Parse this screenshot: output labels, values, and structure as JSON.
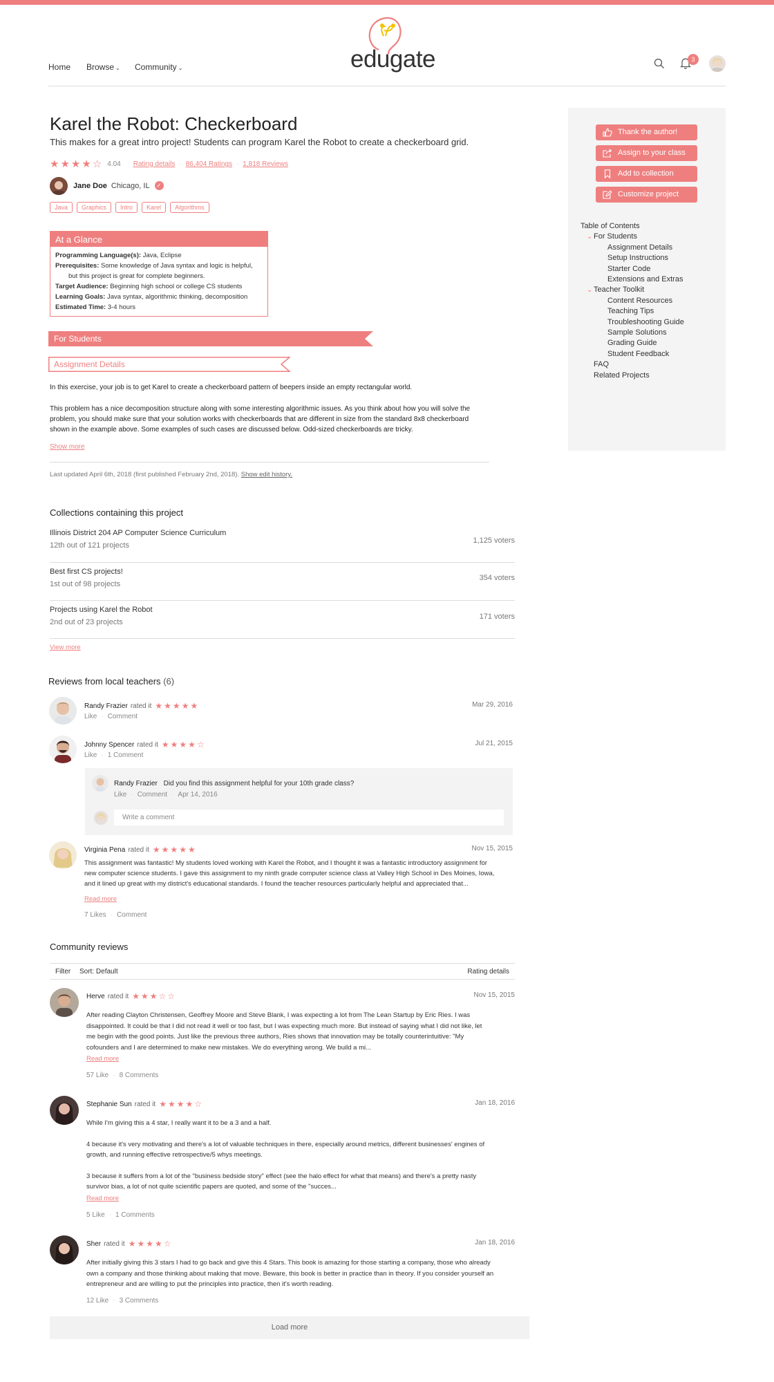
{
  "header": {
    "nav": [
      {
        "label": "Home",
        "dropdown": false
      },
      {
        "label": "Browse",
        "dropdown": true
      },
      {
        "label": "Community",
        "dropdown": true
      }
    ],
    "logo_text": "edugate",
    "notifications_count": "3",
    "accent_color": "#ef7f7f"
  },
  "project": {
    "title": "Karel the Robot: Checkerboard",
    "subtitle": "This makes for a great intro project! Students can program Karel the Robot to create a checkerboard grid.",
    "rating_value": "4.04",
    "rating_stars": 4,
    "rating_details_link": "Rating details",
    "ratings_link": "86,404 Ratings",
    "reviews_link": "1,818 Reviews",
    "author_name": "Jane Doe",
    "author_location": "Chicago, IL",
    "tags": [
      "Java",
      "Graphics",
      "Intro",
      "Karel",
      "Algorithms"
    ]
  },
  "glance": {
    "heading": "At a Glance",
    "items": [
      {
        "label": "Programming Language(s):",
        "value": "Java, Eclipse"
      },
      {
        "label": "Prerequisites:",
        "value": "Some knowledge of Java syntax and logic is helpful,",
        "value2": "but this project is great for complete beginners."
      },
      {
        "label": "Target Audience:",
        "value": "Beginning high school or college CS students"
      },
      {
        "label": "Learning Goals:",
        "value": "Java syntax, algorithmic thinking, decomposition"
      },
      {
        "label": "Estimated Time:",
        "value": "3-4 hours"
      }
    ]
  },
  "content": {
    "section_ribbon": "For Students",
    "subsection_ribbon": "Assignment Details",
    "paragraph1": "In this exercise, your job is to get Karel to create a checkerboard pattern of beepers inside an empty rectangular world.",
    "paragraph2_lines": [
      "This problem has a nice decomposition structure along with some interesting algorithmic issues. As you think about how you will solve the",
      "problem, you should make sure that your solution works with checkerboards that are different in size from the standard 8x8 checkerboard",
      "shown in the example above. Some examples of such cases are discussed below. Odd-sized checkerboards are tricky."
    ],
    "show_more": "Show more",
    "last_updated": "Last updated April 6th, 2018 (first published February 2nd, 2018).",
    "edit_history_link": "Show edit history."
  },
  "collections": {
    "title": "Collections containing this project",
    "items": [
      {
        "name": "Illinois District 204 AP Computer Science Curriculum",
        "rank": "12th out of 121 projects",
        "voters": "1,125 voters"
      },
      {
        "name": "Best first CS projects!",
        "rank": "1st out of 98 projects",
        "voters": "354 voters"
      },
      {
        "name": "Projects using Karel the Robot",
        "rank": "2nd out of 23 projects",
        "voters": "171 voters"
      }
    ],
    "view_more": "View more"
  },
  "local_reviews": {
    "title": "Reviews from local teachers",
    "count": "(6)",
    "rated_it": "rated it",
    "items": [
      {
        "name": "Randy Frazier",
        "stars": 5,
        "date": "Mar 29, 2016",
        "like": "Like",
        "comment": "Comment"
      },
      {
        "name": "Johnny Spencer",
        "stars": 4,
        "date": "Jul 21, 2015",
        "like": "Like",
        "comment": "1 Comment"
      },
      {
        "name": "Virginia Pena",
        "stars": 5,
        "date": "Nov 15, 2015",
        "text_lines": [
          "This assignment was fantastic! My students loved working with Karel the Robot, and I thought it was a fantastic introductory assignment for",
          "new computer science students. I gave this assignment to my ninth grade computer science class at Valley High School in Des Moines, Iowa,",
          "and it lined up great with my district's educational standards. I found the teacher resources particularly helpful and appreciated that..."
        ],
        "read_more": "Read more",
        "like": "7 Likes",
        "comment": "Comment"
      }
    ],
    "reply": {
      "name": "Randy Frazier",
      "text": "Did you find this assignment helpful for your 10th grade class?",
      "like": "Like",
      "comment": "Comment",
      "date": "Apr 14, 2016",
      "input_placeholder": "Write a comment"
    }
  },
  "community": {
    "title": "Community reviews",
    "filter": "Filter",
    "sort_label": "Sort:",
    "sort_value": "Default",
    "rating_details": "Rating details",
    "rated_it": "rated it",
    "items": [
      {
        "name": "Herve",
        "stars": 3,
        "date": "Nov 15, 2015",
        "paragraphs": [
          [
            "After reading Clayton Christensen, Geoffrey Moore and Steve Blank, I was expecting a lot from The Lean Startup by Eric Ries. I was",
            "disappointed. It could be that I did not read it well or too fast, but I was expecting much more. But instead of saying what I did not like, let",
            "me begin with the good points. Just like the previous three authors, Ries shows that innovation may be totally counterintuitive: \"My",
            "cofounders and I are determined to make new mistakes. We do everything wrong. We build a mi..."
          ]
        ],
        "read_more": "Read more",
        "like": "57 Like",
        "comment": "8 Comments"
      },
      {
        "name": "Stephanie Sun",
        "stars": 4,
        "date": "Jan 18, 2016",
        "paragraphs": [
          [
            "While I'm giving this a 4 star, I really want it to be a 3 and a half."
          ],
          [
            "4 because it's very motivating and there's a lot of valuable techniques in there, especially around metrics, different businesses' engines of",
            "growth, and running effective retrospective/5 whys meetings."
          ],
          [
            "3 because it suffers from a lot of the \"business bedside story\" effect (see the halo effect for what that means) and there's a pretty nasty",
            "survivor bias, a lot of not quite scientific papers are quoted, and some of the \"succes..."
          ]
        ],
        "read_more": "Read more",
        "like": "5 Like",
        "comment": "1 Comments"
      },
      {
        "name": "Sher",
        "stars": 4,
        "date": "Jan 18, 2016",
        "paragraphs": [
          [
            "After initially giving this 3 stars I had to go back and give this 4 Stars. This book is amazing for those starting a company, those who already",
            "own a company and those thinking about making that move. Beware, this book is better in practice than in theory. If you consider yourself an",
            "entrepreneur and are willing to put the principles into practice, then it's worth reading."
          ]
        ],
        "read_more": "",
        "like": "12 Like",
        "comment": "3 Comments"
      }
    ],
    "load_more": "Load more"
  },
  "sidebar": {
    "buttons": [
      {
        "label": "Thank the author!",
        "icon": "thumbs-up-icon"
      },
      {
        "label": "Assign to your class",
        "icon": "share-icon"
      },
      {
        "label": "Add to collection",
        "icon": "bookmark-icon"
      },
      {
        "label": "Customize project",
        "icon": "edit-icon"
      }
    ],
    "toc_title": "Table of Contents",
    "toc": [
      {
        "label": "For Students",
        "children": [
          "Assignment Details",
          "Setup Instructions",
          "Starter Code",
          "Extensions and Extras"
        ]
      },
      {
        "label": "Teacher Toolkit",
        "children": [
          "Content Resources",
          "Teaching Tips",
          "Troubleshooting Guide",
          "Sample Solutions",
          "Grading Guide",
          "Student Feedback"
        ]
      },
      {
        "label": "FAQ",
        "children": []
      },
      {
        "label": "Related Projects",
        "children": []
      }
    ]
  }
}
